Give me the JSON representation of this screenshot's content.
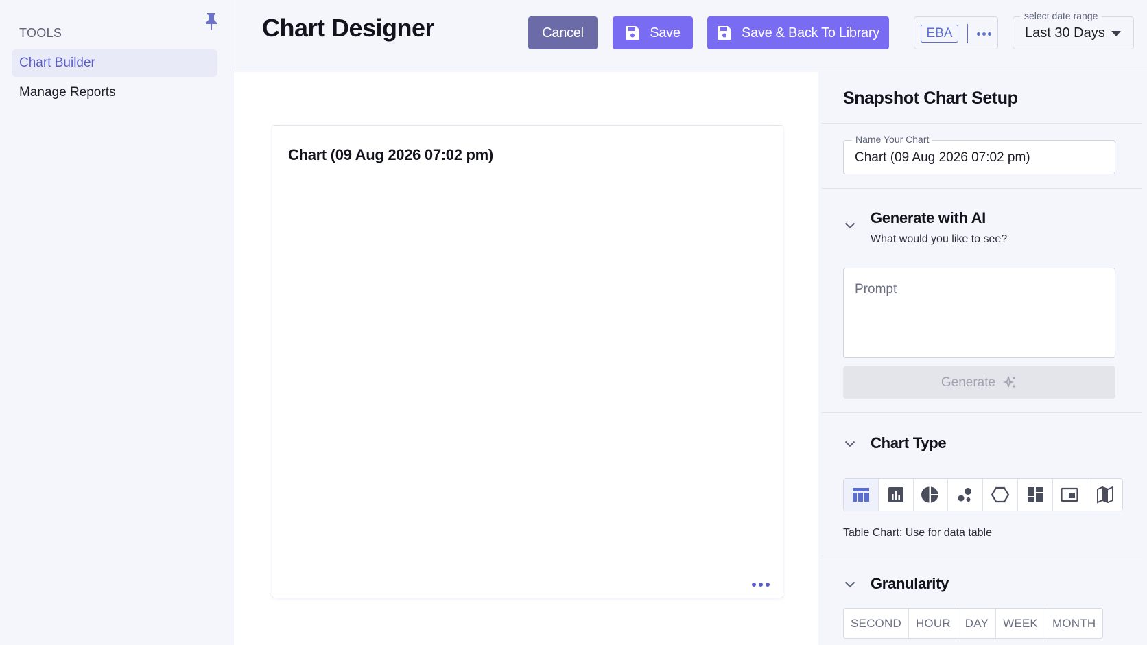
{
  "sidebar": {
    "header": "TOOLS",
    "items": [
      {
        "label": "Chart Builder",
        "active": true
      },
      {
        "label": "Manage Reports",
        "active": false
      }
    ]
  },
  "header": {
    "title": "Chart Designer",
    "cancel_label": "Cancel",
    "save_label": "Save",
    "save_back_label": "Save & Back To Library",
    "org_badge": "EBA",
    "date_range": {
      "label": "select date range",
      "value": "Last 30 Days"
    }
  },
  "canvas": {
    "chart_title": "Chart (09 Aug 2026 07:02 pm)"
  },
  "panel": {
    "title": "Snapshot Chart Setup",
    "name_field": {
      "label": "Name Your Chart",
      "value": "Chart (09 Aug 2026 07:02 pm)"
    },
    "ai": {
      "title": "Generate with AI",
      "subtitle": "What would you like to see?",
      "prompt_placeholder": "Prompt",
      "prompt_value": "",
      "generate_label": "Generate"
    },
    "chart_type": {
      "title": "Chart Type",
      "types": [
        {
          "icon": "table-chart-icon",
          "active": true
        },
        {
          "icon": "bar-chart-icon",
          "active": false
        },
        {
          "icon": "pie-chart-icon",
          "active": false
        },
        {
          "icon": "bubble-chart-icon",
          "active": false
        },
        {
          "icon": "hexagon-chart-icon",
          "active": false
        },
        {
          "icon": "dashboard-grid-icon",
          "active": false
        },
        {
          "icon": "picture-in-picture-icon",
          "active": false
        },
        {
          "icon": "map-icon",
          "active": false
        }
      ],
      "description": "Table Chart: Use for data table"
    },
    "granularity": {
      "title": "Granularity",
      "options": [
        "SECOND",
        "HOUR",
        "DAY",
        "WEEK",
        "MONTH"
      ]
    }
  },
  "colors": {
    "accent": "#7a6cf2",
    "cancel": "#6b6ba8",
    "link": "#5b5fc7",
    "background": "#f5f6fb"
  }
}
